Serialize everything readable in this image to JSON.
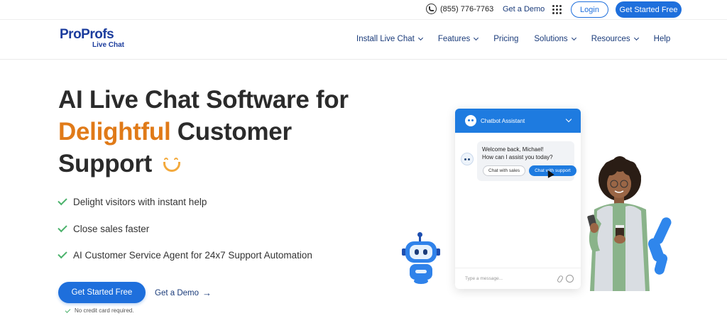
{
  "topbar": {
    "phone": "(855) 776-7763",
    "demo": "Get a Demo",
    "login": "Login",
    "cta": "Get Started Free"
  },
  "logo": {
    "main": "ProProfs",
    "sub": "Live Chat"
  },
  "nav": {
    "items": [
      {
        "label": "Install Live Chat",
        "dropdown": true
      },
      {
        "label": "Features",
        "dropdown": true
      },
      {
        "label": "Pricing",
        "dropdown": false
      },
      {
        "label": "Solutions",
        "dropdown": true
      },
      {
        "label": "Resources",
        "dropdown": true
      },
      {
        "label": "Help",
        "dropdown": false
      }
    ]
  },
  "hero": {
    "title_line1": "AI Live Chat Software for",
    "title_accent": "Delightful",
    "title_line2_rest": " Customer",
    "title_line3": "Support",
    "accent_color": "#e07a18"
  },
  "features": [
    "Delight visitors with instant help",
    "Close sales faster",
    "AI Customer Service Agent for 24x7 Support Automation"
  ],
  "cta": {
    "primary": "Get Started Free",
    "demo": "Get a Demo",
    "note": "No credit card required."
  },
  "chat_widget": {
    "header": "Chatbot Assistant",
    "greeting_line1": "Welcome back, Michael!",
    "greeting_line2": "How can I assist you today?",
    "quick_replies": [
      "Chat with sales",
      "Chat with support"
    ],
    "input_placeholder": "Type a message..."
  },
  "colors": {
    "brand_blue": "#1e6fdc",
    "nav_text": "#1a3b7a",
    "check_green": "#4cb26c"
  }
}
